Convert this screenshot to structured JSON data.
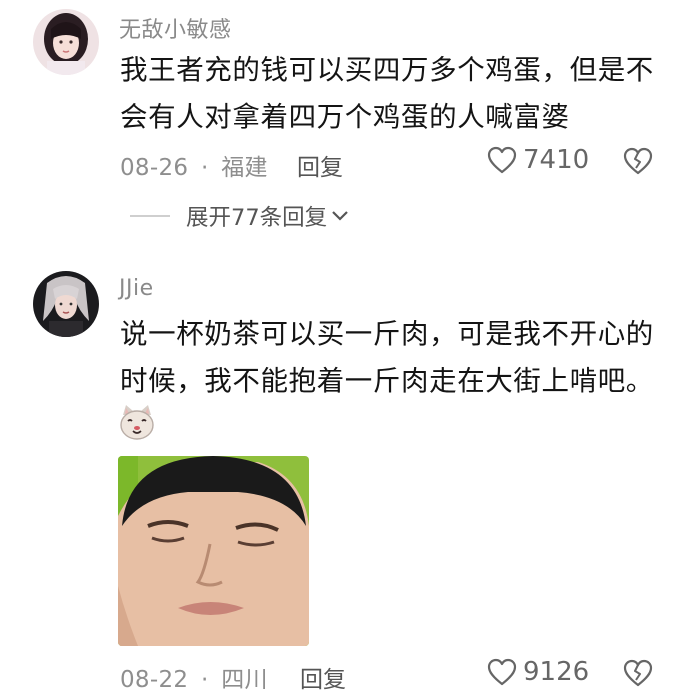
{
  "comments": [
    {
      "username": "无敌小敏感",
      "text": "我王者充的钱可以买四万多个鸡蛋，但是不会有人对拿着四万个鸡蛋的人喊富婆",
      "date": "08-26",
      "separator": "·",
      "location": "福建",
      "reply_label": "回复",
      "likes": "7410",
      "expand_label": "展开77条回复"
    },
    {
      "username": "JJie",
      "text": "说一杯奶茶可以买一斤肉，可是我不开心的时候，我不能抱着一斤肉走在大街上啃吧。",
      "date": "08-22",
      "separator": "·",
      "location": "四川",
      "reply_label": "回复",
      "likes": "9126"
    }
  ],
  "icons": {
    "like": "heart-outline-icon",
    "dislike": "broken-heart-icon",
    "expand": "chevron-down-icon",
    "emoji": "cat-face-emoji"
  },
  "colors": {
    "text": "#141414",
    "meta": "#8e8e8e",
    "username": "#8a8a8a"
  }
}
